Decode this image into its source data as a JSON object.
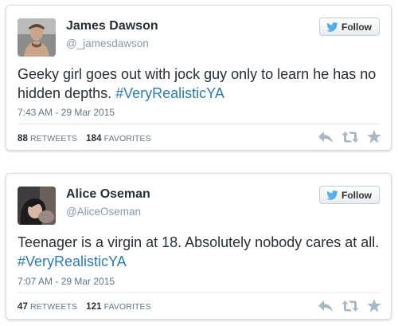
{
  "tweets": [
    {
      "name": "James Dawson",
      "handle": "@_jamesdawson",
      "follow_label": "Follow",
      "text": "Geeky girl goes out with jock guy only to learn he has no hidden depths. ",
      "hashtag": "#VeryRealisticYA",
      "timestamp": "7:43 AM - 29 Mar 2015",
      "retweets": "88",
      "retweets_label": "RETWEETS",
      "favorites": "184",
      "favorites_label": "FAVORITES"
    },
    {
      "name": "Alice Oseman",
      "handle": "@AliceOseman",
      "follow_label": "Follow",
      "text": "Teenager is a virgin at 18. Absolutely nobody cares at all. ",
      "hashtag": "#VeryRealisticYA",
      "timestamp": "7:07 AM - 29 Mar 2015",
      "retweets": "47",
      "retweets_label": "RETWEETS",
      "favorites": "121",
      "favorites_label": "FAVORITES"
    }
  ],
  "icons": {
    "bird": "twitter-bird-icon",
    "reply": "reply-icon",
    "retweet": "retweet-icon",
    "favorite": "star-icon"
  },
  "colors": {
    "link": "#2b7bb9",
    "bird": "#55acee",
    "muted": "#8899a6",
    "icon": "#aab8c2"
  }
}
